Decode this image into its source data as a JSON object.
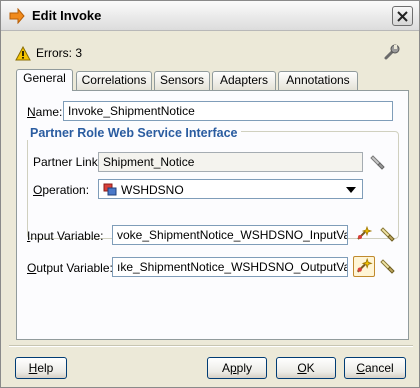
{
  "dialog": {
    "title": "Edit Invoke",
    "errors_label": "Errors: 3"
  },
  "tabs": [
    {
      "label": "General"
    },
    {
      "label": "Correlations"
    },
    {
      "label": "Sensors"
    },
    {
      "label": "Adapters"
    },
    {
      "label": "Annotations"
    }
  ],
  "general": {
    "name_label_prefix": "",
    "name_label_mnemonic": "N",
    "name_label_rest": "ame:",
    "name_value": "Invoke_ShipmentNotice",
    "group_title": "Partner Role Web Service Interface",
    "partner_link_label": "Partner Link:",
    "partner_link_value": "Shipment_Notice",
    "operation_label_prefix": "",
    "operation_label_mnemonic": "O",
    "operation_label_rest": "peration:",
    "operation_value": "WSHDSNO",
    "input_label_prefix": "",
    "input_label_mnemonic": "I",
    "input_label_rest": "nput Variable:",
    "input_value": "voke_ShipmentNotice_WSHDSNO_InputVariable",
    "output_label_prefix": "",
    "output_label_mnemonic": "O",
    "output_label_rest": "utput Variable:",
    "output_value": "ıke_ShipmentNotice_WSHDSNO_OutputVariable"
  },
  "buttons": {
    "help_mnemonic": "H",
    "help_rest": "elp",
    "apply_prefix": "A",
    "apply_mnemonic": "p",
    "apply_rest": "ply",
    "ok_mnemonic": "O",
    "ok_rest": "K",
    "cancel_mnemonic": "C",
    "cancel_rest": "ancel"
  },
  "colors": {
    "accent": "#2a5ca0",
    "warning": "#f5c400",
    "dialog_bg": "#ece9d8"
  },
  "icons": {
    "title": "invoke-arrow-icon",
    "close": "close-icon",
    "errors": "warning-icon",
    "settings": "wrench-icon",
    "partner_link_browse": "flashlight-icon",
    "operation": "operation-icon",
    "create_variable": "create-variable-icon",
    "browse_variable": "flashlight-icon"
  }
}
